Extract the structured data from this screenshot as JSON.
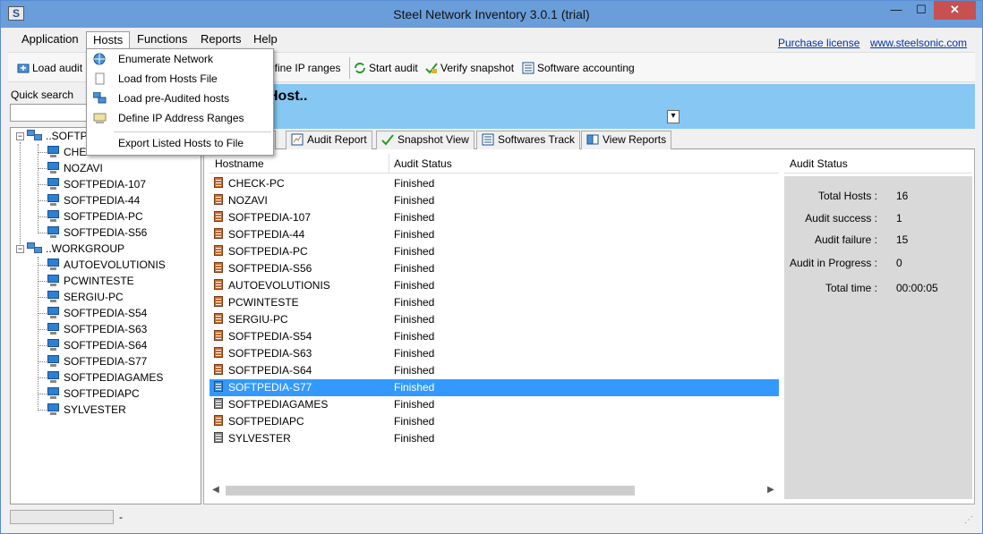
{
  "window": {
    "title": "Steel Network Inventory 3.0.1 (trial)",
    "app_icon_letter": "S",
    "min": "—",
    "max": "☐",
    "close": "✕"
  },
  "menubar": {
    "items": [
      "Application",
      "Hosts",
      "Functions",
      "Reports",
      "Help"
    ]
  },
  "links": {
    "purchase": "Purchase license",
    "site": "www.steelsonic.com"
  },
  "toolbar": {
    "load_audit": "Load audit",
    "define_ip": "efine IP ranges",
    "start_audit": "Start audit",
    "verify_snapshot": "Verify snapshot",
    "software_accounting": "Software accounting"
  },
  "hosts_menu": {
    "items": [
      "Enumerate Network",
      "Load from Hosts File",
      "Load pre-Audited hosts",
      "Define IP Address Ranges",
      "Export Listed Hosts to File"
    ]
  },
  "quick_search": {
    "label": "Quick search",
    "value": ""
  },
  "tree": {
    "groups": [
      {
        "label": "..SOFTP",
        "expander": "−",
        "hosts": [
          "CHECK-PC",
          "NOZAVI",
          "SOFTPEDIA-107",
          "SOFTPEDIA-44",
          "SOFTPEDIA-PC",
          "SOFTPEDIA-S56"
        ]
      },
      {
        "label": "..WORKGROUP",
        "expander": "−",
        "hosts": [
          "AUTOEVOLUTIONIS",
          "PCWINTESTE",
          "SERGIU-PC",
          "SOFTPEDIA-S54",
          "SOFTPEDIA-S63",
          "SOFTPEDIA-S64",
          "SOFTPEDIA-S77",
          "SOFTPEDIAGAMES",
          "SOFTPEDIAPC",
          "SYLVESTER"
        ]
      }
    ]
  },
  "header_band": {
    "title": "Host.."
  },
  "tabs": [
    "ts",
    "Audit Report",
    "Snapshot View",
    "Softwares Track",
    "View Reports"
  ],
  "list": {
    "columns": [
      "Hostname",
      "Audit Status"
    ],
    "rows": [
      {
        "host": "CHECK-PC",
        "status": "Finished",
        "icon": "orange"
      },
      {
        "host": "NOZAVI",
        "status": "Finished",
        "icon": "orange"
      },
      {
        "host": "SOFTPEDIA-107",
        "status": "Finished",
        "icon": "orange"
      },
      {
        "host": "SOFTPEDIA-44",
        "status": "Finished",
        "icon": "orange"
      },
      {
        "host": "SOFTPEDIA-PC",
        "status": "Finished",
        "icon": "orange"
      },
      {
        "host": "SOFTPEDIA-S56",
        "status": "Finished",
        "icon": "orange"
      },
      {
        "host": "AUTOEVOLUTIONIS",
        "status": "Finished",
        "icon": "orange"
      },
      {
        "host": "PCWINTESTE",
        "status": "Finished",
        "icon": "orange"
      },
      {
        "host": "SERGIU-PC",
        "status": "Finished",
        "icon": "orange"
      },
      {
        "host": "SOFTPEDIA-S54",
        "status": "Finished",
        "icon": "orange"
      },
      {
        "host": "SOFTPEDIA-S63",
        "status": "Finished",
        "icon": "orange"
      },
      {
        "host": "SOFTPEDIA-S64",
        "status": "Finished",
        "icon": "orange"
      },
      {
        "host": "SOFTPEDIA-S77",
        "status": "Finished",
        "icon": "blue",
        "selected": true
      },
      {
        "host": "SOFTPEDIAGAMES",
        "status": "Finished",
        "icon": "grey"
      },
      {
        "host": "SOFTPEDIAPC",
        "status": "Finished",
        "icon": "orange"
      },
      {
        "host": "SYLVESTER",
        "status": "Finished",
        "icon": "grey"
      }
    ]
  },
  "audit_status": {
    "title": "Audit Status",
    "stats": [
      {
        "label": "Total Hosts :",
        "value": "16"
      },
      {
        "label": "Audit success :",
        "value": "1"
      },
      {
        "label": "Audit failure :",
        "value": "15"
      },
      {
        "label": "Audit in Progress :",
        "value": "0"
      },
      {
        "label": "Total time :",
        "value": "00:00:05"
      }
    ]
  },
  "statusbar": {
    "text": "-"
  },
  "colors": {
    "title_bar": "#6a9edb",
    "header_band": "#87c7f3",
    "selection": "#3399ff",
    "close_button": "#c75050"
  }
}
